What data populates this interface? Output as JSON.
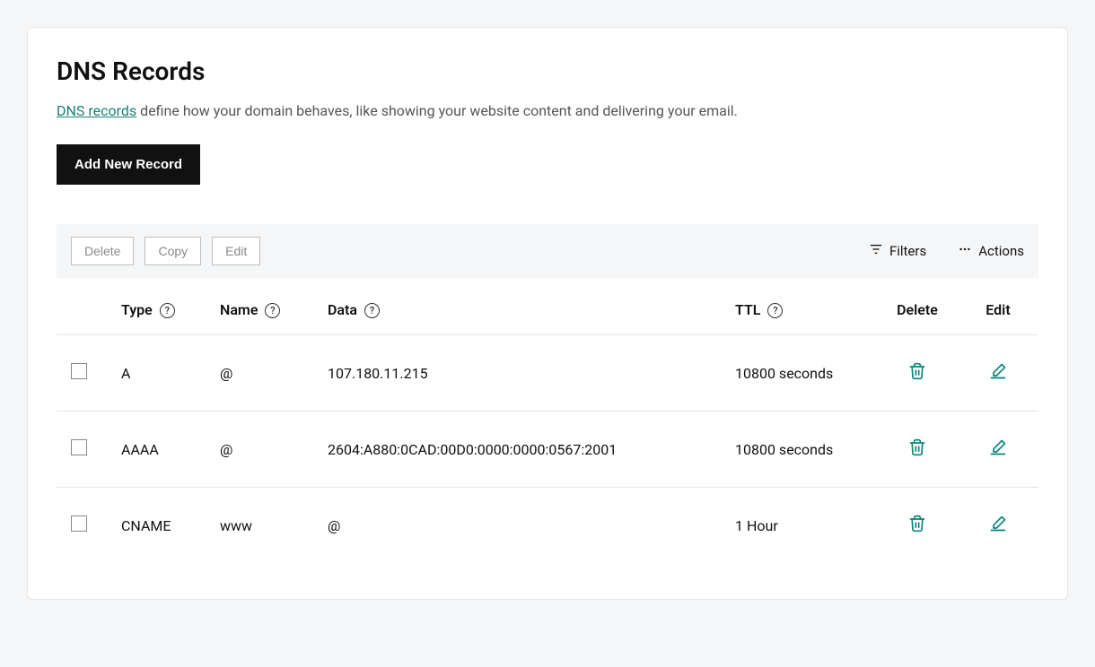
{
  "title": "DNS Records",
  "description": {
    "link_text": "DNS records",
    "rest": " define how your domain behaves, like showing your website content and delivering your email."
  },
  "buttons": {
    "add_new": "Add New Record",
    "delete": "Delete",
    "copy": "Copy",
    "edit": "Edit",
    "filters": "Filters",
    "actions": "Actions"
  },
  "columns": {
    "type": "Type",
    "name": "Name",
    "data": "Data",
    "ttl": "TTL",
    "delete": "Delete",
    "edit": "Edit"
  },
  "records": [
    {
      "type": "A",
      "name": "@",
      "data": "107.180.11.215",
      "ttl": "10800 seconds"
    },
    {
      "type": "AAAA",
      "name": "@",
      "data": "2604:A880:0CAD:00D0:0000:0000:0567:2001",
      "ttl": "10800 seconds"
    },
    {
      "type": "CNAME",
      "name": "www",
      "data": "@",
      "ttl": "1 Hour"
    }
  ]
}
